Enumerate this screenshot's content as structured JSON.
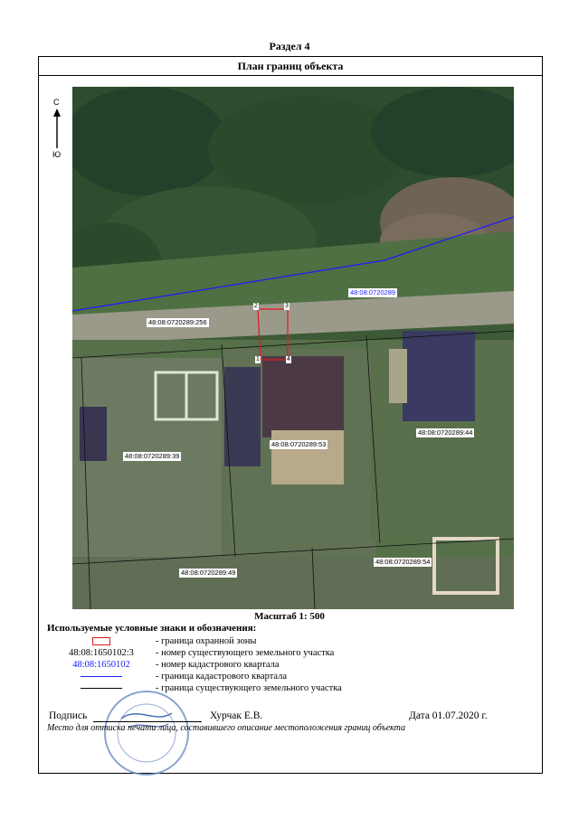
{
  "document": {
    "section": "Раздел 4",
    "title": "План границ объекта"
  },
  "compass": {
    "north": "С",
    "south": "Ю"
  },
  "map": {
    "quarter_label": "48:08:0720289",
    "parcels": [
      "48:08:0720289:256",
      "48:08:0720289:53",
      "48:08:0720289:39",
      "48:08:0720289:44",
      "48:08:0720289:49",
      "48:08:0720289:54"
    ],
    "points": [
      "1",
      "2",
      "3",
      "4"
    ]
  },
  "scale": "Масштаб 1: 500",
  "legend": {
    "title": "Используемые условные знаки и обозначения:",
    "items": [
      {
        "symbol": "",
        "desc": "- граница  охранной зоны"
      },
      {
        "symbol": "48:08:1650102:3",
        "desc": "- номер существующего земельного участка"
      },
      {
        "symbol": "48:08:1650102",
        "desc": "- номер кадастрового квартала"
      },
      {
        "symbol": "",
        "desc": "- граница кадастрового квартала"
      },
      {
        "symbol": "",
        "desc": "- граница существующего земельного участка"
      }
    ]
  },
  "signature": {
    "label": "Подпись",
    "signer": "Хурчак Е.В.",
    "date": "Дата 01.07.2020 г.",
    "stamp_note": "Место для оттиска печати лица, составившего описание местоположения границ объекта"
  },
  "colors": {
    "protection_zone": "#e0191e",
    "quarter_boundary": "#1a1aff",
    "parcel_boundary": "#000000"
  }
}
